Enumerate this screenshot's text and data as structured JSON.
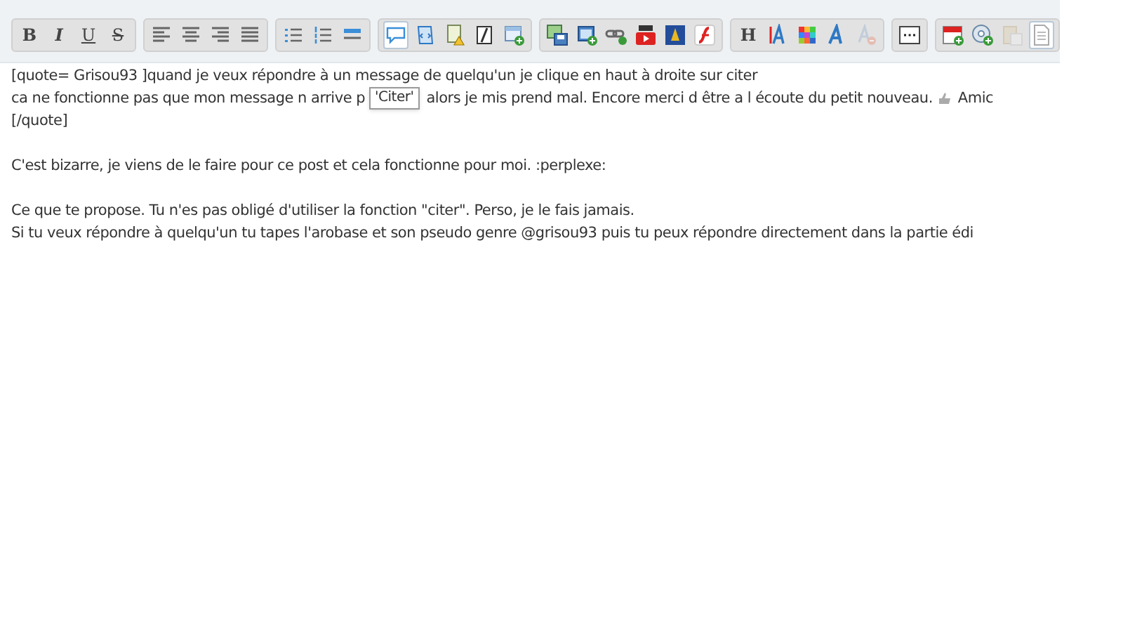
{
  "toolbar": {
    "groups": [
      {
        "buttons": [
          {
            "kind": "text",
            "label": "B",
            "selected": false,
            "disabled": false
          },
          {
            "kind": "text",
            "label": "I",
            "selected": false,
            "disabled": false
          },
          {
            "kind": "text",
            "label": "U",
            "selected": false,
            "disabled": false
          },
          {
            "kind": "text",
            "label": "S",
            "selected": false,
            "disabled": false
          }
        ]
      },
      {
        "buttons": [
          {
            "kind": "icon",
            "selected": false,
            "disabled": false
          },
          {
            "kind": "icon",
            "selected": false,
            "disabled": false
          },
          {
            "kind": "icon",
            "selected": false,
            "disabled": false
          },
          {
            "kind": "icon",
            "selected": false,
            "disabled": false
          }
        ]
      },
      {
        "buttons": [
          {
            "kind": "icon",
            "selected": false,
            "disabled": false
          },
          {
            "kind": "icon",
            "selected": false,
            "disabled": false
          },
          {
            "kind": "icon",
            "selected": false,
            "disabled": false
          }
        ]
      },
      {
        "buttons": [
          {
            "kind": "icon",
            "selected": true,
            "disabled": false
          },
          {
            "kind": "icon",
            "selected": false,
            "disabled": false
          },
          {
            "kind": "icon",
            "selected": false,
            "disabled": false
          },
          {
            "kind": "icon",
            "selected": false,
            "disabled": false
          },
          {
            "kind": "icon",
            "selected": false,
            "disabled": false
          }
        ]
      },
      {
        "buttons": [
          {
            "kind": "icon",
            "selected": false,
            "disabled": false
          },
          {
            "kind": "icon",
            "selected": false,
            "disabled": false
          },
          {
            "kind": "icon",
            "selected": false,
            "disabled": false
          },
          {
            "kind": "icon",
            "selected": false,
            "disabled": false
          },
          {
            "kind": "icon",
            "selected": false,
            "disabled": false
          },
          {
            "kind": "icon",
            "selected": false,
            "disabled": false
          }
        ]
      },
      {
        "buttons": [
          {
            "kind": "text",
            "label": "H",
            "selected": false,
            "disabled": false
          },
          {
            "kind": "icon",
            "selected": false,
            "disabled": false
          },
          {
            "kind": "icon",
            "selected": false,
            "disabled": false
          },
          {
            "kind": "icon",
            "selected": false,
            "disabled": false
          },
          {
            "kind": "icon",
            "selected": false,
            "disabled": true
          }
        ]
      },
      {
        "buttons": [
          {
            "kind": "icon",
            "selected": false,
            "disabled": false
          }
        ]
      },
      {
        "buttons": [
          {
            "kind": "icon",
            "selected": false,
            "disabled": false
          },
          {
            "kind": "icon",
            "selected": false,
            "disabled": false
          },
          {
            "kind": "icon",
            "selected": false,
            "disabled": true
          },
          {
            "kind": "icon",
            "selected": true,
            "disabled": false
          }
        ]
      }
    ]
  },
  "tooltip": {
    "text": "'Citer'"
  },
  "editor": {
    "lines": [
      {
        "kind": "text",
        "text": "[quote= Grisou93 ]quand je veux répondre à un message de quelqu'un je clique en haut à droite sur citer"
      },
      {
        "kind": "covered",
        "before": "ca ne fonctionne pas que mon message n arrive p",
        "after": "alors je mis prend mal. Encore merci d être a l écoute du petit nouveau.",
        "end": "Amic"
      },
      {
        "kind": "text",
        "text": "[/quote]"
      },
      {
        "kind": "blank"
      },
      {
        "kind": "text",
        "text": "C'est bizarre, je viens de le faire pour ce post et cela fonctionne pour moi. :perplexe:"
      },
      {
        "kind": "blank"
      },
      {
        "kind": "text",
        "text": "Ce que te propose. Tu n'es pas obligé d'utiliser la fonction \"citer\". Perso, je le fais jamais."
      },
      {
        "kind": "text",
        "text": "Si tu veux répondre à quelqu'un tu tapes l'arobase et son pseudo genre @grisou93 puis tu peux répondre directement dans la partie édi"
      }
    ]
  }
}
